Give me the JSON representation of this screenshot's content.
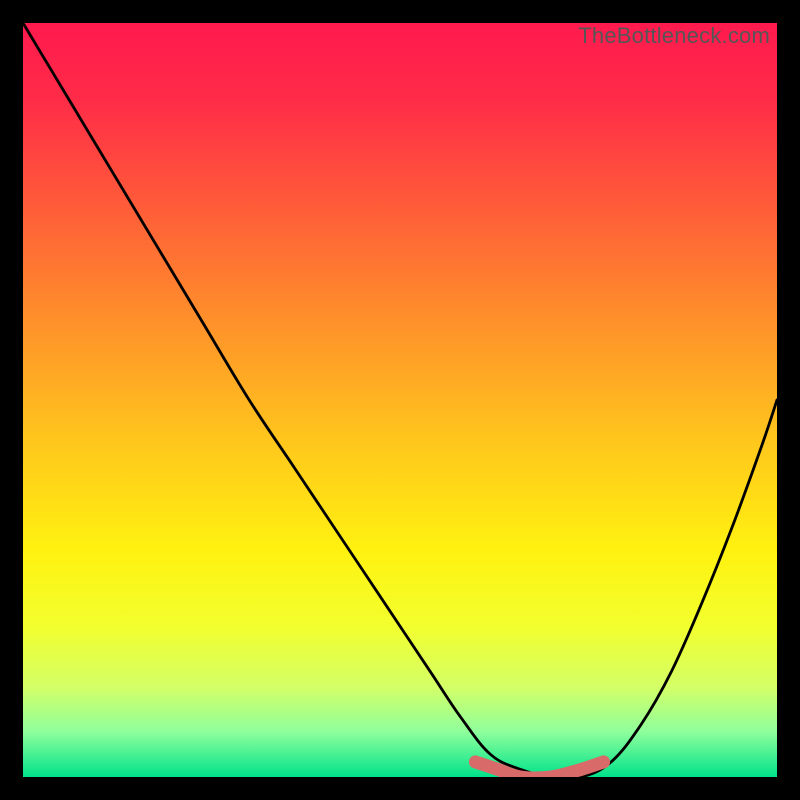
{
  "watermark": "TheBottleneck.com",
  "gradient_stops": [
    {
      "offset": 0.0,
      "color": "#ff1a4e"
    },
    {
      "offset": 0.1,
      "color": "#ff2b48"
    },
    {
      "offset": 0.25,
      "color": "#ff5e38"
    },
    {
      "offset": 0.4,
      "color": "#ff922a"
    },
    {
      "offset": 0.55,
      "color": "#ffc51d"
    },
    {
      "offset": 0.7,
      "color": "#fff210"
    },
    {
      "offset": 0.8,
      "color": "#f2ff2e"
    },
    {
      "offset": 0.88,
      "color": "#d4ff66"
    },
    {
      "offset": 0.94,
      "color": "#8fff9c"
    },
    {
      "offset": 1.0,
      "color": "#00e28a"
    }
  ],
  "chart_data": {
    "type": "line",
    "title": "",
    "xlabel": "",
    "ylabel": "",
    "xlim": [
      0,
      100
    ],
    "ylim": [
      0,
      100
    ],
    "series": [
      {
        "name": "bottleneck-curve",
        "x": [
          0,
          6,
          12,
          18,
          24,
          30,
          36,
          42,
          48,
          54,
          58,
          62,
          66,
          70,
          74,
          78,
          82,
          86,
          90,
          94,
          98,
          100
        ],
        "values": [
          100,
          90,
          80,
          70,
          60,
          50,
          41,
          32,
          23,
          14,
          8,
          3,
          1,
          0,
          0,
          2,
          7,
          14,
          23,
          33,
          44,
          50
        ]
      },
      {
        "name": "highlight-band",
        "x": [
          60,
          63,
          66,
          70,
          74,
          77
        ],
        "values": [
          2,
          1,
          0,
          0,
          1,
          2
        ]
      }
    ],
    "annotations": []
  }
}
